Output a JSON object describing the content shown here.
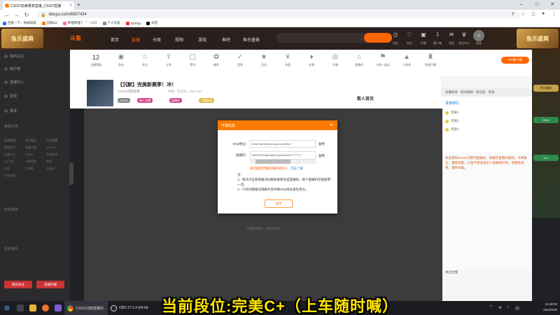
{
  "browser": {
    "tab_title": "CSGO完美赛季直播_CSGO直播",
    "url": "douyu.com/8567434",
    "bookmarks": [
      "百度一下，你就知道",
      "沉默bot",
      "哔哩哔哩 (゜-゜)つロ",
      "个人信息",
      "SEPlay",
      "抖音"
    ]
  },
  "site": {
    "logo": "斗鱼",
    "nav": {
      "home": "首页",
      "live": "直播",
      "category": "分类",
      "video": "视频",
      "game": "游戏",
      "esports": "鱼吧",
      "music": "鱼乐盛典"
    },
    "banner": "鱼乐盛典",
    "header_right": [
      "历史",
      "关注",
      "开播",
      "客户端",
      "消息",
      "会员中心",
      "登录"
    ]
  },
  "sidebar": {
    "top": [
      "我的关注",
      "排行榜",
      "直播中心",
      "发现",
      "赛事"
    ],
    "section_recommend": "推荐分类",
    "recommend": [
      "英雄联盟",
      "和平精英",
      "王者荣耀",
      "绝地求生",
      "穿越火线",
      "DOTA2",
      "无限火力",
      "CSGO",
      "主机游戏",
      "QQ飞车",
      "守望先锋",
      "传奇",
      "DNF",
      "三国杀",
      "王者天下",
      "斗鱼全部"
    ],
    "section_hot": "单机热游",
    "section_ent": "更多娱乐",
    "follow_btn": "我的关注",
    "follow_btn2": "直播开播"
  },
  "toolbar": {
    "count": "12",
    "items": [
      "主播等级",
      "鱼丸",
      "关注",
      "分享",
      "背包",
      "福利",
      "签到",
      "活动",
      "充值",
      "礼物",
      "开播",
      "直播间",
      "斗鱼一起玩",
      "小游戏",
      "快速开播",
      "贵族"
    ]
  },
  "room": {
    "title": "【沉默】完美新赛季！冲！",
    "owner": "CSGO沉默直播",
    "owner_meta": "举报  ·  房间号：8567434",
    "pills": [
      "CSGO",
      "新人主播",
      "直播中",
      "主播勋章"
    ],
    "score_label": "数人首页"
  },
  "player": {
    "hint": "主播暂时离开，请稍后再来"
  },
  "dialog": {
    "title": "开播信息",
    "rtmp_label": "rtmp地址：",
    "rtmp_value": "rtmp://sendtc3a.douyu.com/live",
    "code_label": "直播码：",
    "code_value": "8567434rVqD4dMi47ps9ecretv**********",
    "copy": "复制",
    "warn": "请勿随意泄露开播码给他人",
    "learn": "点击了解",
    "notes_title": "注：",
    "notes": [
      "1、每次点击获取推流码都会重新生成直播码，每个直播码仅能使用一次。",
      "2、只有切换推流线路才会导致rtmp地址发生变化。"
    ],
    "confirm": "关闭"
  },
  "right_panel": {
    "pc_btn": "PC客户端",
    "tabs": [
      "主播榜单",
      "周贡献榜",
      "粉丝团",
      "贵族"
    ],
    "rank_title": "贵族排行",
    "rank_rows": [
      "贵族1",
      "贵族2",
      "贵族3"
    ],
    "notice": "欢迎来到CSGO沉默的直播间，请遵守直播间规则，文明发言，理性观看，斗鱼严禁未成年人直播或打赏。请理性消费，谨防诈骗。",
    "follow": "关注主播",
    "ad": [
      "鱼乐盛典",
      "5254",
      "14.1"
    ]
  },
  "subtitle": "当前段位:完美C+（上车随时喊）",
  "taskbar": {
    "apps": [
      "Chrome",
      "OBS"
    ],
    "chrome_label": "CSGO沉默直播间...",
    "obs_label": "OBS 27.2.4 (64-bit)",
    "time": "19:38:08",
    "date": "2022/9/19"
  },
  "colors": {
    "accent": "#ff7a00",
    "subtitle": "#ffe600"
  }
}
